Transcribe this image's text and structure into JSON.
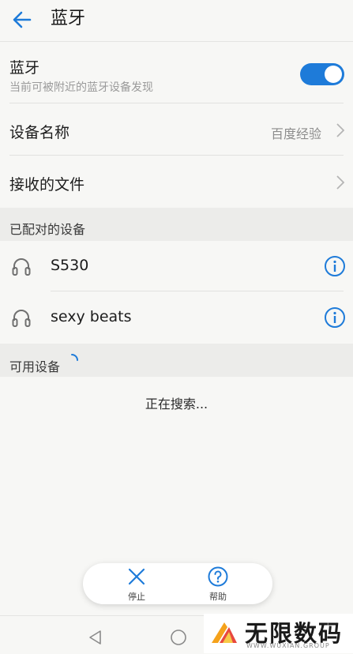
{
  "header": {
    "title": "蓝牙"
  },
  "bluetooth": {
    "label": "蓝牙",
    "subtitle": "当前可被附近的蓝牙设备发现",
    "enabled": true,
    "accent": "#1e7bd9"
  },
  "device_name": {
    "label": "设备名称",
    "value": "百度经验"
  },
  "received_files": {
    "label": "接收的文件"
  },
  "paired": {
    "section_label": "已配对的设备",
    "devices": [
      {
        "name": "S530",
        "icon": "headphones-icon"
      },
      {
        "name": "sexy beats",
        "icon": "headphones-icon"
      }
    ]
  },
  "available": {
    "section_label": "可用设备",
    "status": "正在搜索..."
  },
  "actions": {
    "stop_label": "停止",
    "help_label": "帮助"
  },
  "watermark": {
    "text": "无限数码",
    "sub": "WWW.WUXIAN.GROUP"
  }
}
